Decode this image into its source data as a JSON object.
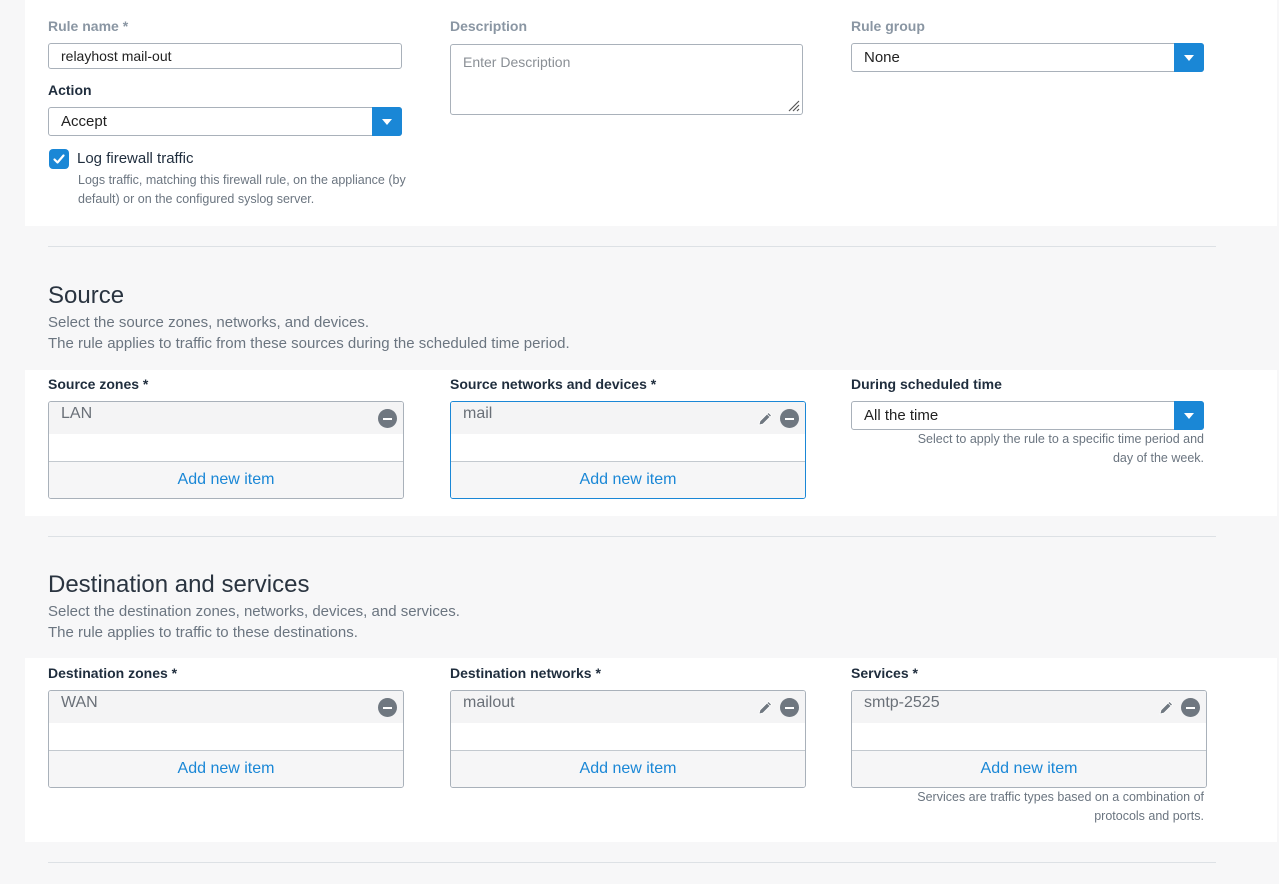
{
  "general": {
    "rule_name_label": "Rule name *",
    "rule_name_value": "relayhost mail-out",
    "description_label": "Description",
    "description_placeholder": "Enter Description",
    "rule_group_label": "Rule group",
    "rule_group_value": "None",
    "action_label": "Action",
    "action_value": "Accept",
    "log_label": "Log firewall traffic",
    "log_checked": true,
    "log_hint_line1": "Logs traffic, matching this firewall rule, on the appliance (by",
    "log_hint_line2": "default) or on the configured syslog server."
  },
  "source": {
    "title": "Source",
    "desc_line1": "Select the source zones, networks, and devices.",
    "desc_line2": "The rule applies to traffic from these sources during the scheduled time period.",
    "zones_label": "Source zones *",
    "zones_item": "LAN",
    "networks_label": "Source networks and devices *",
    "networks_item": "mail",
    "schedule_label": "During scheduled time",
    "schedule_value": "All the time",
    "schedule_hint_line1": "Select to apply the rule to a specific time period and",
    "schedule_hint_line2": "day of the week.",
    "add_label": "Add new item"
  },
  "destination": {
    "title": "Destination and services",
    "desc_line1": "Select the destination zones, networks, devices, and services.",
    "desc_line2": "The rule applies to traffic to these destinations.",
    "zones_label": "Destination zones *",
    "zones_item": "WAN",
    "networks_label": "Destination networks *",
    "networks_item": "mailout",
    "services_label": "Services *",
    "services_item": "smtp-2525",
    "services_hint_line1": "Services are traffic types based on a combination of",
    "services_hint_line2": "protocols and ports.",
    "add_label": "Add new item"
  },
  "colors": {
    "accent": "#1a87d6",
    "border": "#a9b1ba"
  }
}
